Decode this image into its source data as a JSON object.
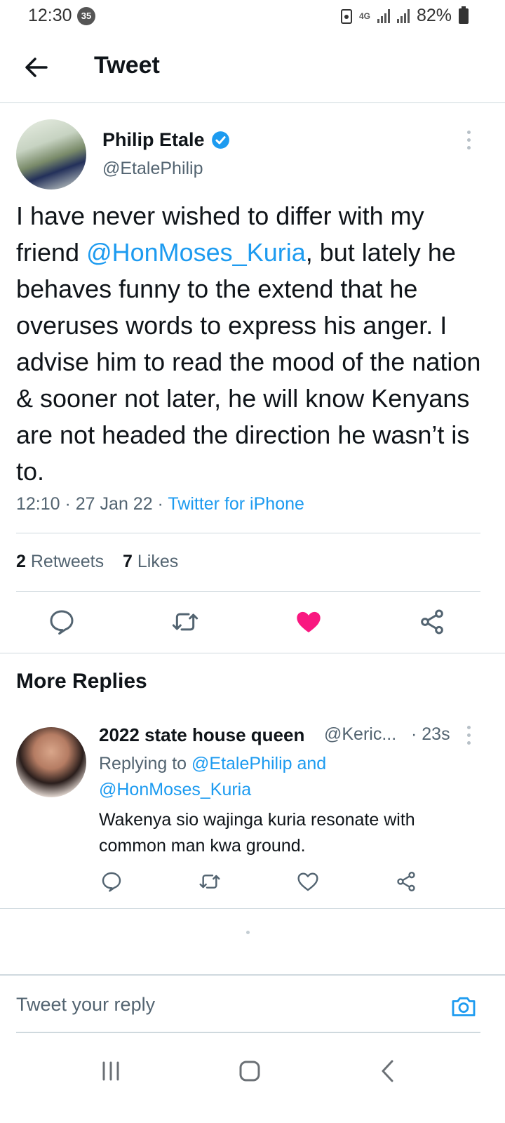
{
  "status_bar": {
    "time": "12:30",
    "notification_count": "35",
    "network": "4G",
    "battery": "82%"
  },
  "header": {
    "title": "Tweet"
  },
  "tweet": {
    "author_name": "Philip Etale",
    "author_handle": "@EtalePhilip",
    "text_before_mention": "I have never wished to differ with my friend ",
    "mention": "@HonMoses_Kuria",
    "text_after_mention": ", but lately he behaves funny to the extend that he overuses words to express his anger. I advise him to read the mood of the nation & sooner not later, he will know Kenyans are not headed the direction he wasn’t is to.",
    "time": "12:10",
    "date": "27 Jan 22",
    "source": "Twitter for iPhone",
    "retweets_count": "2",
    "retweets_label": "Retweets",
    "likes_count": "7",
    "likes_label": "Likes",
    "liked": true
  },
  "more_replies": {
    "heading": "More Replies",
    "items": [
      {
        "name": "2022 state house queen",
        "handle": "@Keric...",
        "time": "· 23s",
        "replying_prefix": "Replying to ",
        "replying_to_1": "@EtalePhilip",
        "replying_and": " and",
        "replying_to_2": "@HonMoses_Kuria",
        "text": "Wakenya sio wajinga kuria resonate with common man kwa ground."
      }
    ]
  },
  "composer": {
    "placeholder": "Tweet your reply"
  },
  "colors": {
    "accent": "#1d9bf0",
    "like": "#f91880",
    "text": "#0f1419",
    "secondary": "#536471"
  }
}
